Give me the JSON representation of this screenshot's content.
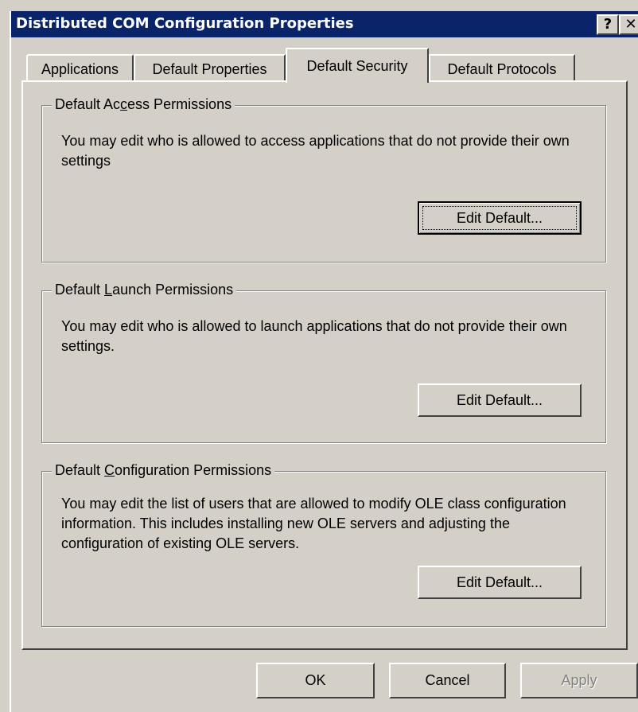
{
  "window": {
    "title": "Distributed COM Configuration Properties",
    "help_glyph": "?",
    "close_glyph": "✕"
  },
  "tabs": [
    {
      "label": "Applications",
      "active": false
    },
    {
      "label": "Default Properties",
      "active": false
    },
    {
      "label": "Default Security",
      "active": true
    },
    {
      "label": "Default Protocols",
      "active": false
    }
  ],
  "groups": {
    "access": {
      "legend_pre": "Default Ac",
      "legend_accel": "c",
      "legend_post": "ess Permissions",
      "description": "You may edit who is allowed to access applications that do not provide their own settings",
      "button_label": "Edit Default..."
    },
    "launch": {
      "legend_pre": "Default ",
      "legend_accel": "L",
      "legend_post": "aunch Permissions",
      "description": "You may edit who is allowed to launch applications that do not provide their own settings.",
      "button_label": "Edit Default..."
    },
    "configuration": {
      "legend_pre": "Default ",
      "legend_accel": "C",
      "legend_post": "onfiguration Permissions",
      "description": "You may edit the list of users that are allowed to modify OLE class configuration information.  This includes installing new OLE servers and adjusting the configuration of existing OLE servers.",
      "button_label": "Edit Default..."
    }
  },
  "buttons": {
    "ok": "OK",
    "cancel": "Cancel",
    "apply": "Apply"
  },
  "colors": {
    "titlebar": "#0a246a",
    "face": "#d4d0c8",
    "disabled_text": "#808080"
  }
}
